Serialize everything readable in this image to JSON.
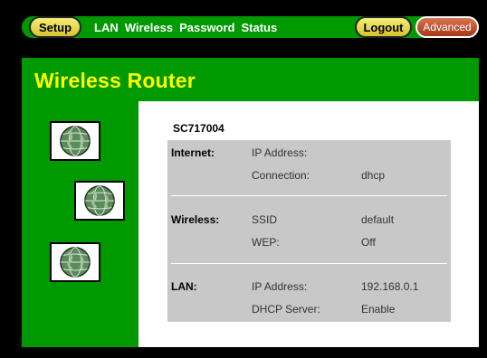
{
  "nav": {
    "setup_label": "Setup",
    "links": [
      "LAN",
      "Wireless",
      "Password",
      "Status"
    ],
    "logout_label": "Logout",
    "advanced_label": "Advanced"
  },
  "header": {
    "title": "Wireless Router"
  },
  "sidebar": {
    "icons": [
      "globe-icon",
      "globe-icon",
      "globe-icon"
    ]
  },
  "status": {
    "device_name": "SC717004",
    "internet": {
      "label": "Internet:",
      "ip_label": "IP Address:",
      "ip_value": "",
      "conn_label": "Connection:",
      "conn_value": "dhcp"
    },
    "wireless": {
      "label": "Wireless:",
      "ssid_label": "SSID",
      "ssid_value": "default",
      "wep_label": "WEP:",
      "wep_value": "Off"
    },
    "lan": {
      "label": "LAN:",
      "ip_label": "IP Address:",
      "ip_value": "192.168.0.1",
      "dhcp_label": "DHCP Server:",
      "dhcp_value": "Enable"
    }
  },
  "colors": {
    "green": "#009900",
    "title_yellow": "#ffff00",
    "table_gray": "#c8c8c8"
  }
}
